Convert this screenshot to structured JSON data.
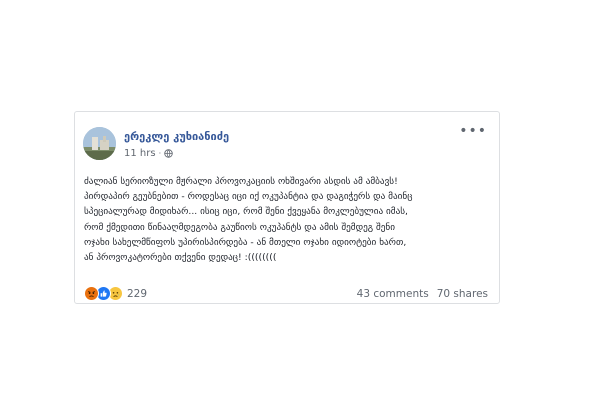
{
  "post": {
    "author": "ერეკლე კუხიანიძე",
    "time": "11 hrs",
    "time_separator": "·",
    "more_label": "•••",
    "text_lines": [
      "ძალიან სერიოზული მჟრალი პროვოკაციის ოხშივარი ასდის ამ ამბავს!",
      "პირდაპირ გეუბნებით - როდესაც იცი იქ ოკუპანტია და დაგიჭერს და მაინც",
      "სპეციალურად მიდიხარ... ისიც იცი, რომ შენი ქვეყანა მოკლებულია იმას,",
      "რომ ქმედითი წინააღმდეგობა გაუწიოს ოკუპანტს და ამის შემდეგ შენი",
      "ოჯახი სახელმწიფოს უპირისპირდება - ან მთელი ოჯახი იდიოტები ხართ,",
      "ან პროვოკატორები თქვენი დედაც! :(((((((("
    ],
    "reactions": {
      "icons": [
        "angry-icon",
        "like-icon",
        "sad-icon"
      ],
      "count": "229"
    },
    "comments": "43 comments",
    "shares": "70 shares"
  }
}
